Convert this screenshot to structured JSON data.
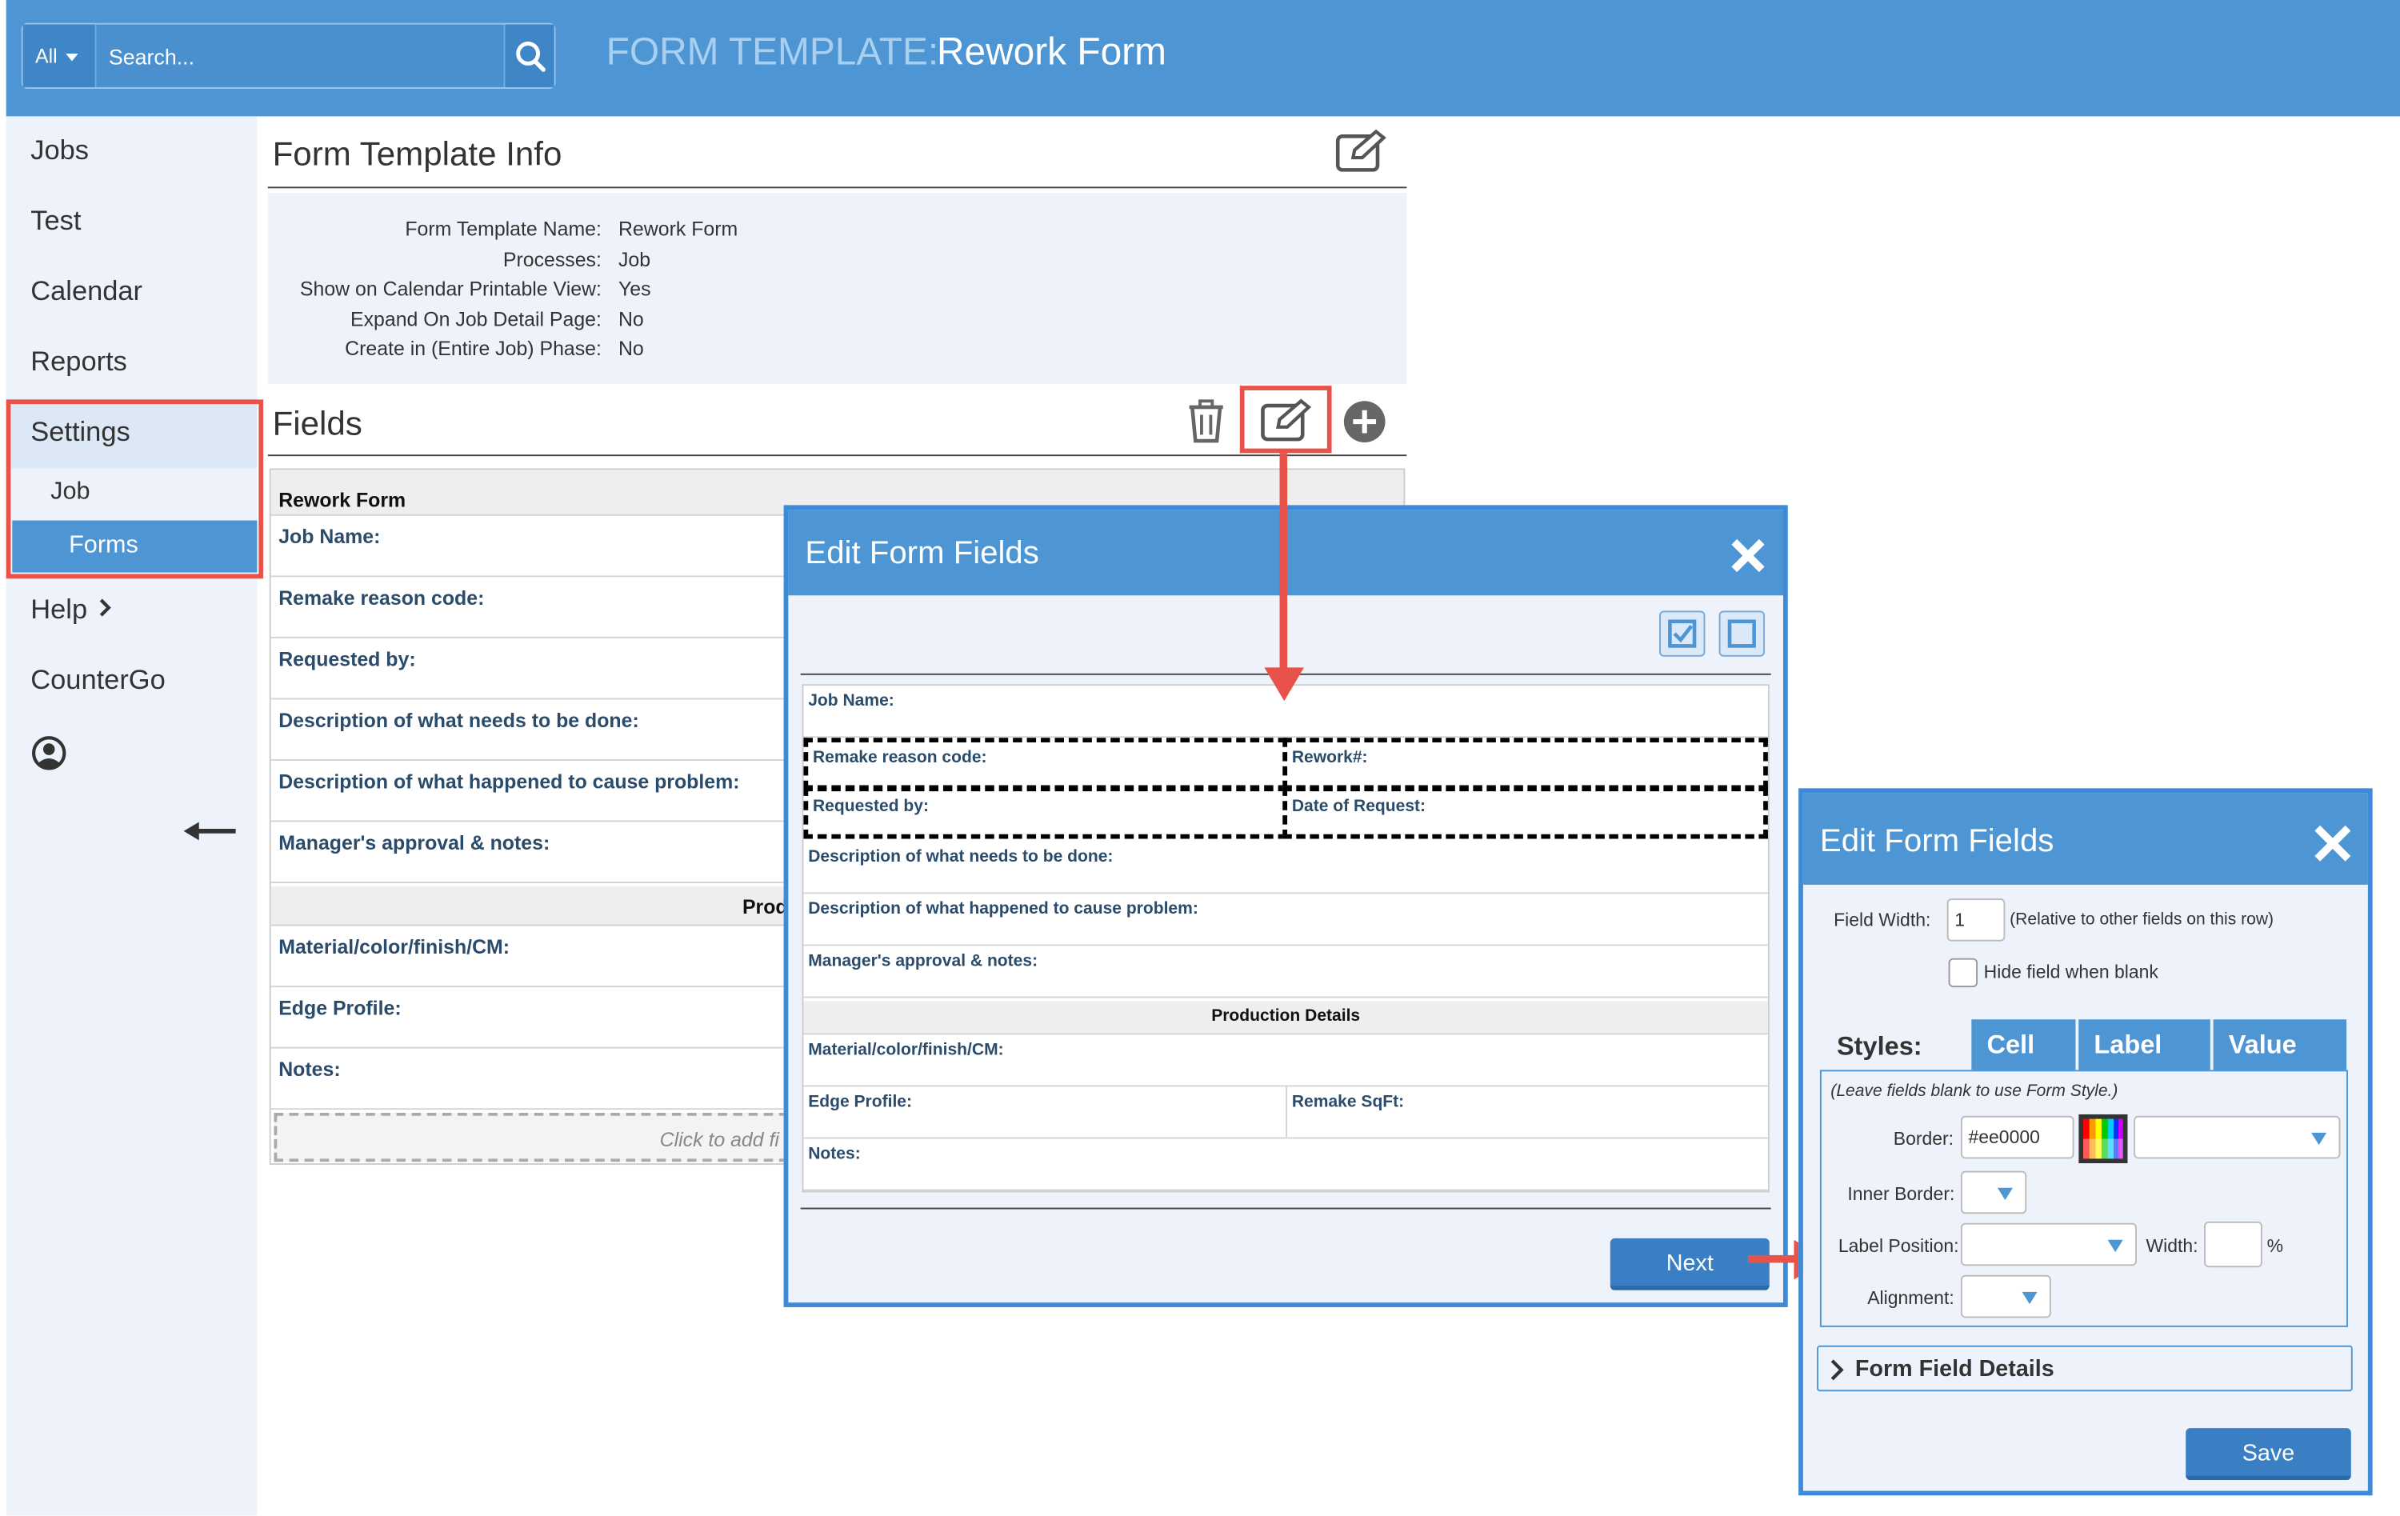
{
  "search": {
    "scope": "All",
    "placeholder": "Search..."
  },
  "header": {
    "prefix": "FORM TEMPLATE:",
    "name": "Rework Form"
  },
  "sidebar": {
    "items": [
      "Jobs",
      "Test",
      "Calendar",
      "Reports",
      "Settings"
    ],
    "settings_sub": [
      "Job",
      "Forms"
    ],
    "help": "Help",
    "countergo": "CounterGo"
  },
  "info": {
    "title": "Form Template Info",
    "rows": [
      {
        "label": "Form Template Name:",
        "value": "Rework Form"
      },
      {
        "label": "Processes:",
        "value": "Job"
      },
      {
        "label": "Show on Calendar Printable View:",
        "value": "Yes"
      },
      {
        "label": "Expand On Job Detail Page:",
        "value": "No"
      },
      {
        "label": "Create in (Entire Job) Phase:",
        "value": "No"
      }
    ]
  },
  "fields": {
    "title": "Fields",
    "form_name": "Rework Form",
    "rows": [
      "Job Name:",
      "Remake reason code:",
      "Requested by:",
      "Description of what needs to be done:",
      "Description of what happened to cause problem:",
      "Manager's approval & notes:"
    ],
    "section": "Prod",
    "rows2": [
      "Material/color/finish/CM:",
      "Edge Profile:",
      "Notes:"
    ],
    "click_add": "Click to add fi"
  },
  "modal1": {
    "title": "Edit Form Fields",
    "job_name": "Job Name:",
    "remake": "Remake reason code:",
    "rework": "Rework#:",
    "requested": "Requested by:",
    "date_req": "Date of Request:",
    "desc1": "Description of what needs to be done:",
    "desc2": "Description of what happened to cause problem:",
    "manager": "Manager's approval & notes:",
    "section": "Production Details",
    "material": "Material/color/finish/CM:",
    "edge": "Edge Profile:",
    "sqft": "Remake SqFt:",
    "notes": "Notes:",
    "next": "Next"
  },
  "modal2": {
    "title": "Edit Form Fields",
    "field_width_label": "Field Width:",
    "field_width_value": "1",
    "field_width_hint": "(Relative to other fields on this row)",
    "hide_blank": "Hide field when blank",
    "styles": "Styles:",
    "tabs": [
      "Cell",
      "Label",
      "Value"
    ],
    "hint": "(Leave fields blank to use Form Style.)",
    "border_label": "Border:",
    "border_value": "#ee0000",
    "inner_border": "Inner Border:",
    "label_position": "Label Position:",
    "width_label": "Width:",
    "percent": "%",
    "alignment": "Alignment:",
    "details": "Form Field Details",
    "save": "Save"
  },
  "colors": {
    "accent": "#4e95d4",
    "highlight": "#e9524a",
    "panel": "#eef3fb"
  }
}
